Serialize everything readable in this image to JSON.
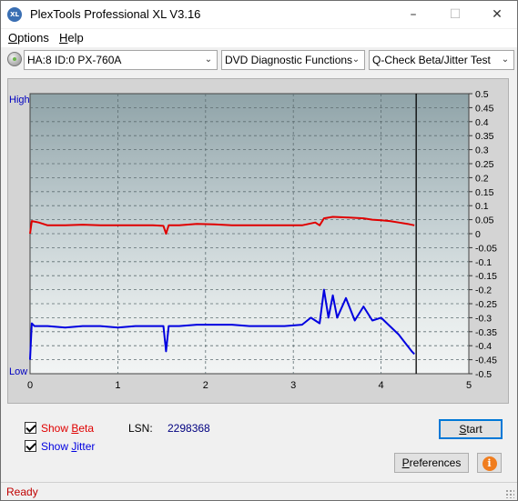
{
  "window": {
    "title": "PlexTools Professional XL V3.16",
    "icon": "XL"
  },
  "menu": {
    "items": [
      {
        "pre": "",
        "accel": "O",
        "post": "ptions"
      },
      {
        "pre": "",
        "accel": "H",
        "post": "elp"
      }
    ]
  },
  "toolbar": {
    "drive": "HA:8 ID:0  PX-760A",
    "function": "DVD Diagnostic Functions",
    "test": "Q-Check Beta/Jitter Test"
  },
  "chart_data": {
    "type": "line",
    "left_axis_labels": {
      "top": "High",
      "bottom": "Low"
    },
    "x_ticks": [
      "0",
      "1",
      "2",
      "3",
      "4",
      "5"
    ],
    "xlim": [
      0,
      5
    ],
    "y_ticks": [
      "0.5",
      "0.45",
      "0.4",
      "0.35",
      "0.3",
      "0.25",
      "0.2",
      "0.15",
      "0.1",
      "0.05",
      "0",
      "-0.05",
      "-0.1",
      "-0.15",
      "-0.2",
      "-0.25",
      "-0.3",
      "-0.35",
      "-0.4",
      "-0.45",
      "-0.5"
    ],
    "ylim": [
      -0.5,
      0.5
    ],
    "end_marker_x": 4.4,
    "series": [
      {
        "color": "#e00000",
        "x": [
          0,
          0.02,
          0.1,
          0.2,
          0.4,
          0.6,
          0.8,
          1.0,
          1.2,
          1.4,
          1.52,
          1.55,
          1.58,
          1.7,
          1.9,
          2.1,
          2.3,
          2.5,
          2.7,
          2.9,
          3.1,
          3.25,
          3.3,
          3.35,
          3.45,
          3.6,
          3.8,
          3.9,
          4.0,
          4.1,
          4.2,
          4.3,
          4.38
        ],
        "y": [
          0.0,
          0.045,
          0.04,
          0.03,
          0.03,
          0.032,
          0.03,
          0.03,
          0.03,
          0.03,
          0.028,
          0.0,
          0.03,
          0.03,
          0.035,
          0.033,
          0.03,
          0.03,
          0.03,
          0.03,
          0.03,
          0.04,
          0.03,
          0.055,
          0.06,
          0.058,
          0.055,
          0.05,
          0.048,
          0.045,
          0.04,
          0.035,
          0.03
        ]
      },
      {
        "color": "#0000e0",
        "x": [
          0,
          0.02,
          0.05,
          0.2,
          0.4,
          0.6,
          0.8,
          1.0,
          1.2,
          1.4,
          1.52,
          1.55,
          1.58,
          1.7,
          1.9,
          2.1,
          2.3,
          2.5,
          2.7,
          2.9,
          3.1,
          3.2,
          3.3,
          3.35,
          3.4,
          3.45,
          3.5,
          3.6,
          3.7,
          3.8,
          3.9,
          4.0,
          4.1,
          4.2,
          4.3,
          4.35,
          4.38
        ],
        "y": [
          -0.45,
          -0.32,
          -0.33,
          -0.33,
          -0.335,
          -0.33,
          -0.33,
          -0.335,
          -0.33,
          -0.33,
          -0.33,
          -0.42,
          -0.33,
          -0.33,
          -0.325,
          -0.325,
          -0.325,
          -0.33,
          -0.33,
          -0.33,
          -0.325,
          -0.3,
          -0.32,
          -0.2,
          -0.3,
          -0.22,
          -0.3,
          -0.23,
          -0.31,
          -0.26,
          -0.31,
          -0.3,
          -0.33,
          -0.36,
          -0.4,
          -0.42,
          -0.43
        ]
      }
    ]
  },
  "controls": {
    "show_beta": {
      "pre": "Show ",
      "accel": "B",
      "post": "eta",
      "checked": true
    },
    "show_jitter": {
      "pre": "Show ",
      "accel": "J",
      "post": "itter",
      "checked": true
    },
    "lsn_label": "LSN:",
    "lsn_value": "2298368",
    "start_button": {
      "pre": "",
      "accel": "S",
      "post": "tart"
    },
    "preferences_button": {
      "pre": "",
      "accel": "P",
      "post": "references"
    },
    "info_icon": "i"
  },
  "status": {
    "text": "Ready"
  },
  "colors": {
    "beta": "#e00000",
    "jitter": "#0000e0",
    "accent": "#0078d7"
  }
}
